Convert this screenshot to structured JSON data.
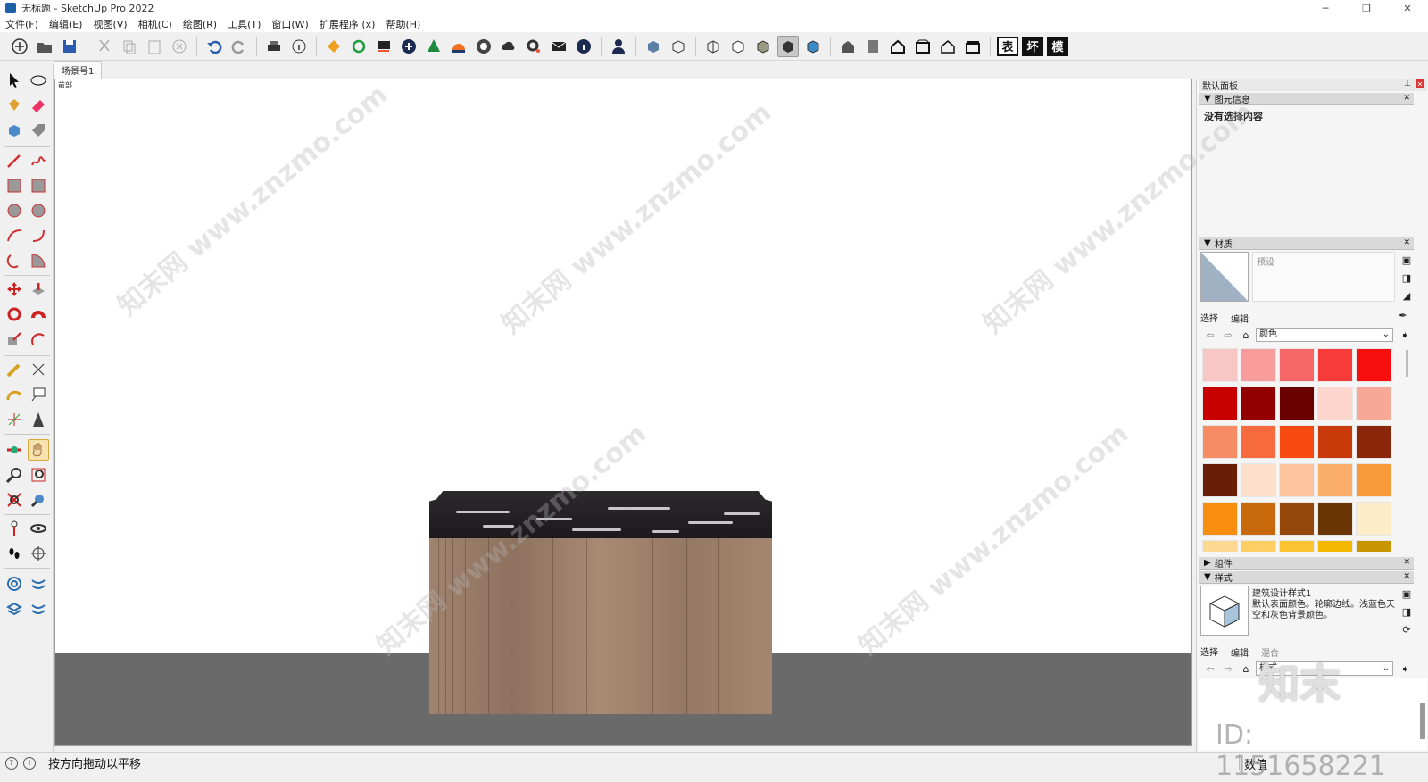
{
  "window": {
    "title": "无标题 - SketchUp Pro 2022",
    "minimize": "─",
    "maximize": "❐",
    "close": "✕"
  },
  "menu": [
    "文件(F)",
    "编辑(E)",
    "视图(V)",
    "相机(C)",
    "绘图(R)",
    "工具(T)",
    "窗口(W)",
    "扩展程序 (x)",
    "帮助(H)"
  ],
  "toolbar": {
    "text_buttons": [
      "表",
      "坏",
      "模"
    ]
  },
  "scene_tab": "场景号1",
  "viewport": {
    "view_label": "前部"
  },
  "right_panel": {
    "tray_title": "默认面板",
    "entity_info": {
      "header": "图元信息",
      "content": "没有选择内容"
    },
    "materials": {
      "header": "材质",
      "preset_name": "预设",
      "tab_select": "选择",
      "tab_edit": "编辑",
      "library": "颜色",
      "swatches": [
        "#f9c6c6",
        "#f99c9c",
        "#f76666",
        "#f73a3a",
        "#f70e0e",
        "#c80000",
        "#930000",
        "#6a0000",
        "#fcd6cc",
        "#f7a896",
        "#f78c64",
        "#f76a3e",
        "#f64a10",
        "#c83a0a",
        "#8c260a",
        "#6a1e06",
        "#fce0cc",
        "#fcc49c",
        "#fbaf6a",
        "#f99a3a",
        "#f78e10",
        "#c8680c",
        "#96480a",
        "#6a3606",
        "#fcecc8",
        "#fcd890",
        "#fcce64",
        "#fcc430",
        "#f5b800",
        "#c89600"
      ]
    },
    "components": {
      "header": "组件"
    },
    "styles": {
      "header": "样式",
      "style_name": "建筑设计样式1",
      "description": "默认表面颜色。轮廓边线。浅蓝色天空和灰色背景颜色。",
      "tab_select": "选择",
      "tab_edit": "编辑",
      "tab_mix": "混合",
      "library": "样式"
    }
  },
  "statusbar": {
    "message": "按方向拖动以平移",
    "vcb_label": "数值"
  },
  "watermarks": {
    "site": "知末网 www.znzmo.com",
    "logo": "知末",
    "id": "ID: 1151658221"
  }
}
